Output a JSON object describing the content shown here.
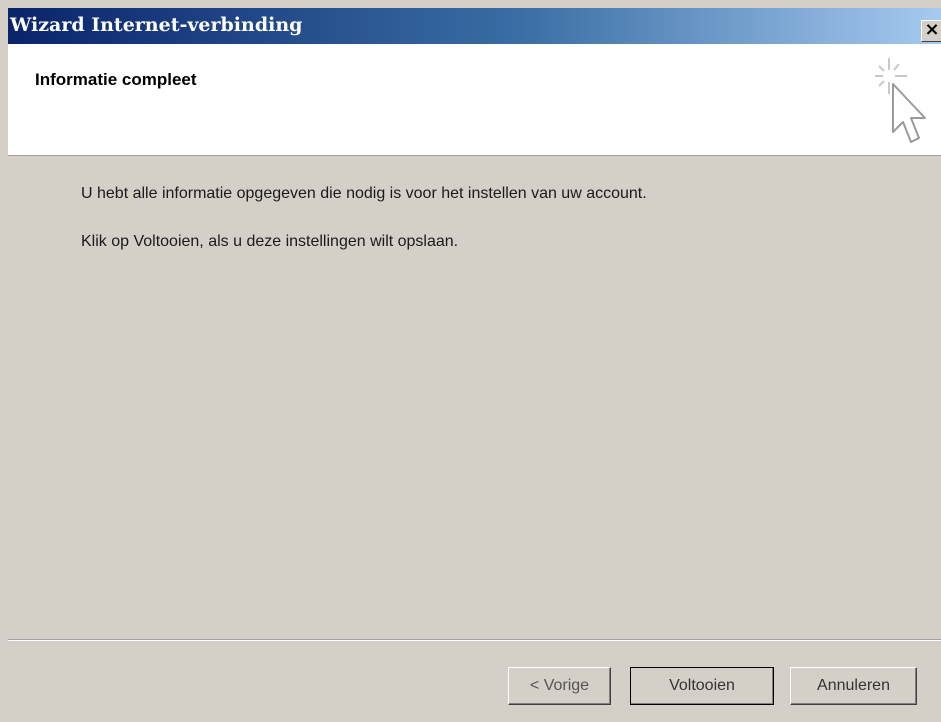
{
  "window": {
    "title": "Wizard Internet-verbinding",
    "close_label": "×"
  },
  "header": {
    "title": "Informatie compleet",
    "icon": "wizard-cursor-icon"
  },
  "content": {
    "message_1": "U hebt alle informatie opgegeven die nodig is voor het instellen van uw account.",
    "message_2": "Klik op Voltooien, als u deze instellingen wilt opslaan."
  },
  "buttons": {
    "back": "< Vorige",
    "finish": "Voltooien",
    "cancel": "Annuleren"
  },
  "colors": {
    "titlebar_start": "#0a246a",
    "titlebar_end": "#a6caf0",
    "dialog_bg": "#d4d0c8",
    "header_bg": "#ffffff"
  }
}
